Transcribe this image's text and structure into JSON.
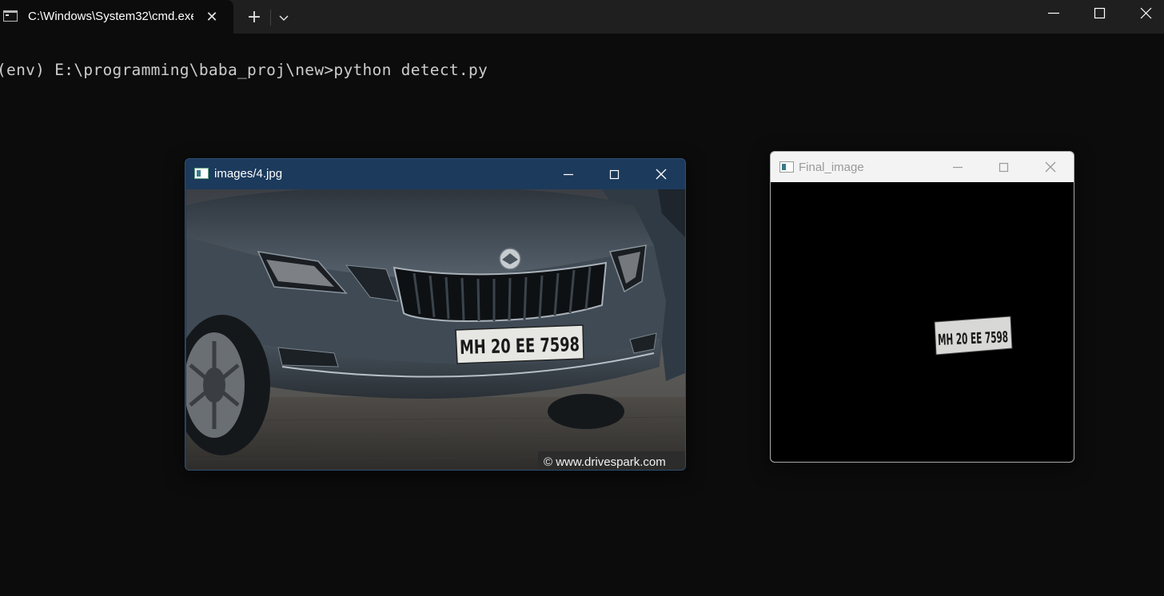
{
  "terminal": {
    "tab_title": "C:\\Windows\\System32\\cmd.exe",
    "tab_close_glyph": "✕",
    "new_tab_glyph": "+",
    "command_line": "(env) E:\\programming\\baba_proj\\new>python detect.py"
  },
  "image_window": {
    "title": "images/4.jpg",
    "plate_text": "MH 20 EE 7598",
    "watermark": "© www.drivespark.com"
  },
  "final_window": {
    "title": "Final_image",
    "plate_text": "MH 20 EE 7598"
  },
  "icons": {
    "tab_icon": "terminal-icon",
    "window_icon": "opencv-window-icon",
    "minimize": "minimize-icon",
    "maximize": "maximize-icon",
    "close": "close-icon",
    "dropdown": "chevron-down-icon"
  },
  "colors": {
    "terminal_bg": "#0c0c0c",
    "tabbar_bg": "#1f1f1f",
    "active_titlebar": "#1c3a5c",
    "inactive_titlebar": "#f3f3f3"
  }
}
